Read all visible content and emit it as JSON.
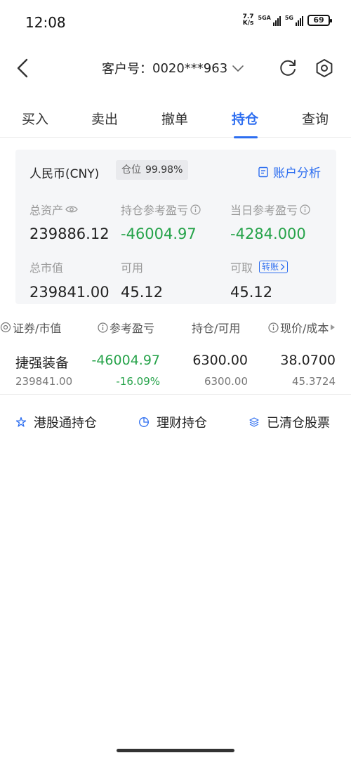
{
  "status_bar": {
    "time": "12:08",
    "speed_value": "7.7",
    "speed_unit": "K/s",
    "network1": "5GA",
    "network2": "5G",
    "battery": "69"
  },
  "header": {
    "account_label": "客户号：",
    "account_number": "0020***963"
  },
  "tabs": [
    {
      "label": "买入"
    },
    {
      "label": "卖出"
    },
    {
      "label": "撤单"
    },
    {
      "label": "持仓"
    },
    {
      "label": "查询"
    }
  ],
  "summary": {
    "currency": "人民币(CNY)",
    "position_label": "仓位",
    "position_value": "99.98%",
    "analysis_link": "账户分析",
    "total_assets_label": "总资产",
    "total_assets": "239886.12",
    "holding_pl_label": "持仓参考盈亏",
    "holding_pl": "-46004.97",
    "today_pl_label": "当日参考盈亏",
    "today_pl": "-4284.000",
    "market_value_label": "总市值",
    "market_value": "239841.00",
    "available_label": "可用",
    "available": "45.12",
    "withdrawable_label": "可取",
    "transfer_label": "转账",
    "withdrawable": "45.12"
  },
  "holdings_header": {
    "col1": "证券/市值",
    "col2": "参考盈亏",
    "col3": "持仓/可用",
    "col4": "现价/成本"
  },
  "holdings": [
    {
      "name": "捷强装备",
      "market_value": "239841.00",
      "pl": "-46004.97",
      "pl_pct": "-16.09%",
      "holding": "6300.00",
      "available": "6300.00",
      "price": "38.0700",
      "cost": "45.3724"
    }
  ],
  "quick_links": [
    {
      "label": "港股通持仓",
      "icon": "hk-connect-icon"
    },
    {
      "label": "理财持仓",
      "icon": "pie-chart-icon"
    },
    {
      "label": "已清仓股票",
      "icon": "layers-icon"
    }
  ],
  "colors": {
    "accent": "#2d6ef0",
    "loss": "#26a34a"
  }
}
